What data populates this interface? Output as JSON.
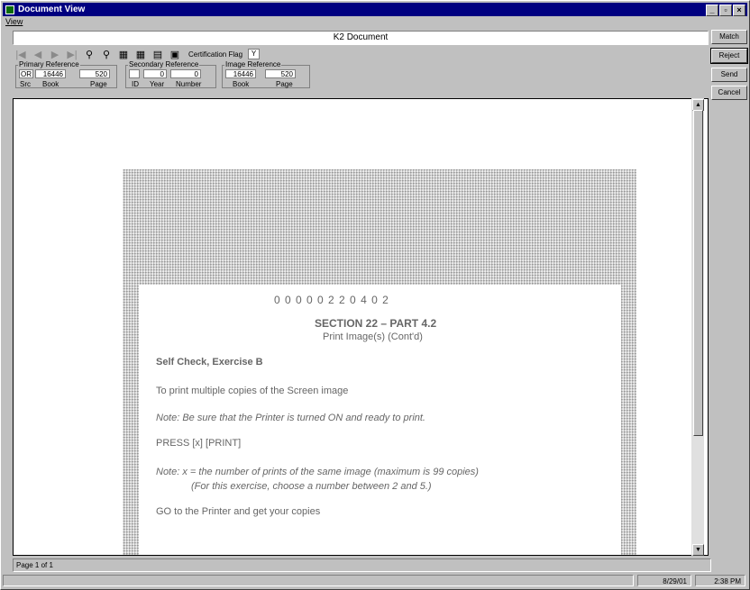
{
  "window": {
    "title": "Document View"
  },
  "menu": {
    "view": "View"
  },
  "document_title": "K2 Document",
  "toolbar": {
    "certification_label": "Certification Flag",
    "certification_value": "Y",
    "icons": [
      "first-page-icon",
      "prev-page-icon",
      "next-page-icon",
      "last-page-icon",
      "zoom-in-icon",
      "zoom-out-icon",
      "rotate-left-icon",
      "rotate-right-icon",
      "fit-width-icon",
      "fit-page-icon"
    ]
  },
  "primary_reference": {
    "legend": "Primary Reference",
    "src": "OR",
    "book": "16446",
    "page": "520",
    "labels": {
      "src": "Src",
      "book": "Book",
      "page": "Page"
    }
  },
  "secondary_reference": {
    "legend": "Secondary Reference",
    "id": "",
    "year": "0",
    "number": "0",
    "labels": {
      "id": "ID",
      "year": "Year",
      "number": "Number"
    }
  },
  "image_reference": {
    "legend": "Image Reference",
    "book": "16446",
    "page": "520",
    "labels": {
      "book": "Book",
      "page": "Page"
    }
  },
  "side_buttons": {
    "match": "Match",
    "reject": "Reject",
    "send": "Send",
    "cancel": "Cancel"
  },
  "document": {
    "number": "0 0 0 0 0 2 2 0 4 0 2",
    "section": "SECTION 22 – PART 4.2",
    "subtitle": "Print Image(s) (Cont'd)",
    "heading": "Self Check, Exercise B",
    "line1": "To print multiple copies of the Screen image",
    "note1": "Note: Be sure that the Printer is turned ON and ready to print.",
    "press": "PRESS [x] [PRINT]",
    "note2a": "Note: x =  the number of prints of the same image (maximum is 99 copies)",
    "note2b": "(For this exercise, choose a number between 2 and 5.)",
    "line2": "GO to the Printer and get your copies"
  },
  "page_indicator": "Page 1 of 1",
  "status": {
    "date": "8/29/01",
    "time": "2:38 PM"
  }
}
